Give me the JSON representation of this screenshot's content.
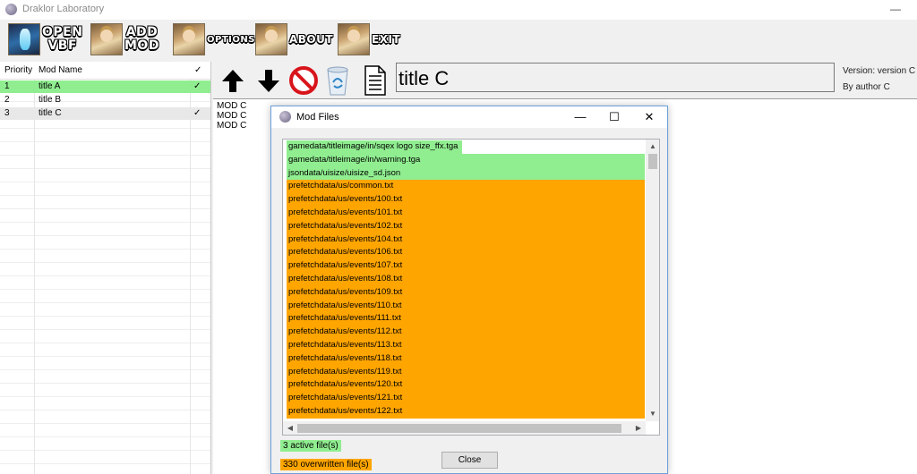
{
  "window": {
    "title": "Draklor Laboratory",
    "minimize": "—"
  },
  "toolbar": {
    "open": "OPEN VBF",
    "open_line1": "OPEN",
    "open_line2": "VBF",
    "add_line1": "ADD",
    "add_line2": "MOD",
    "options": "OPTIONS",
    "about": "ABOUT",
    "exit": "EXIT"
  },
  "modlist": {
    "headers": {
      "priority": "Priority",
      "name": "Mod Name",
      "check": "✓"
    },
    "rows": [
      {
        "priority": "1",
        "name": "title A",
        "check": "✓",
        "state": "active"
      },
      {
        "priority": "2",
        "name": "title B",
        "check": "",
        "state": "normal"
      },
      {
        "priority": "3",
        "name": "title C",
        "check": "✓",
        "state": "selected"
      }
    ]
  },
  "mod": {
    "name": "title C",
    "version": "Version: version C",
    "author": "By author C",
    "description": [
      "MOD C",
      "MOD C",
      "MOD C"
    ]
  },
  "icons": [
    "arrow-up-icon",
    "arrow-down-icon",
    "no-entry-icon",
    "recycle-bin-icon",
    "document-icon"
  ],
  "dialog": {
    "title": "Mod Files",
    "files": [
      {
        "path": "gamedata/titleimage/in/sqex logo size_ffx.tga",
        "state": "active"
      },
      {
        "path": "gamedata/titleimage/in/warning.tga",
        "state": "active"
      },
      {
        "path": "jsondata/uisize/uisize_sd.json",
        "state": "active"
      },
      {
        "path": "prefetchdata/us/common.txt",
        "state": "overwritten"
      },
      {
        "path": "prefetchdata/us/events/100.txt",
        "state": "overwritten"
      },
      {
        "path": "prefetchdata/us/events/101.txt",
        "state": "overwritten"
      },
      {
        "path": "prefetchdata/us/events/102.txt",
        "state": "overwritten"
      },
      {
        "path": "prefetchdata/us/events/104.txt",
        "state": "overwritten"
      },
      {
        "path": "prefetchdata/us/events/106.txt",
        "state": "overwritten"
      },
      {
        "path": "prefetchdata/us/events/107.txt",
        "state": "overwritten"
      },
      {
        "path": "prefetchdata/us/events/108.txt",
        "state": "overwritten"
      },
      {
        "path": "prefetchdata/us/events/109.txt",
        "state": "overwritten"
      },
      {
        "path": "prefetchdata/us/events/110.txt",
        "state": "overwritten"
      },
      {
        "path": "prefetchdata/us/events/111.txt",
        "state": "overwritten"
      },
      {
        "path": "prefetchdata/us/events/112.txt",
        "state": "overwritten"
      },
      {
        "path": "prefetchdata/us/events/113.txt",
        "state": "overwritten"
      },
      {
        "path": "prefetchdata/us/events/118.txt",
        "state": "overwritten"
      },
      {
        "path": "prefetchdata/us/events/119.txt",
        "state": "overwritten"
      },
      {
        "path": "prefetchdata/us/events/120.txt",
        "state": "overwritten"
      },
      {
        "path": "prefetchdata/us/events/121.txt",
        "state": "overwritten"
      },
      {
        "path": "prefetchdata/us/events/122.txt",
        "state": "overwritten"
      }
    ],
    "active_count": "3 active file(s)",
    "overwritten_count": "330 overwritten file(s)",
    "close_label": "Close",
    "minimize": "—",
    "maximize": "☐",
    "close_x": "✕"
  },
  "colors": {
    "active": "#90ee90",
    "overwritten": "#ffa500",
    "selected": "#e8e8e8"
  }
}
